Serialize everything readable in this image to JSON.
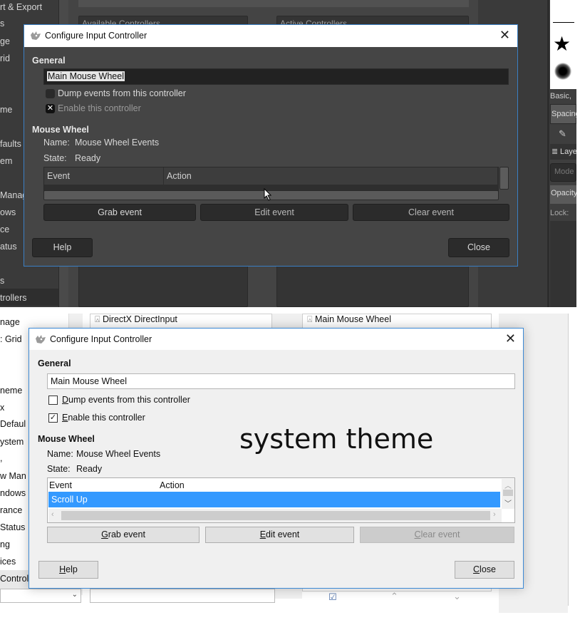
{
  "dark_theme": {
    "sidebar_items": [
      "rt & Export",
      "s",
      "ge",
      "rid",
      "me",
      "faults",
      "em",
      "Manag",
      "ows",
      "ce",
      "atus",
      "s",
      "trollers"
    ],
    "available_controllers_label": "Available Controllers",
    "active_controllers_label": "Active Controllers",
    "right_dock": {
      "brush_preset_label": "Basic,",
      "spacing_label": "Spacing",
      "layers_label": "Laye",
      "mode_label": "Mode",
      "opacity_label": "Opacity",
      "lock_label": "Lock:"
    },
    "dialog": {
      "title": "Configure Input Controller",
      "general_header": "General",
      "name_value": "Main Mouse Wheel",
      "dump_events_label": "Dump events from this controller",
      "dump_events_checked": false,
      "enable_label": "Enable this controller",
      "enable_checked": true,
      "section_header": "Mouse Wheel",
      "name_label": "Name:",
      "name_info": "Mouse Wheel Events",
      "state_label": "State:",
      "state_info": "Ready",
      "table_headers": [
        "Event",
        "Action"
      ],
      "buttons": {
        "grab": "Grab event",
        "edit": "Edit event",
        "clear": "Clear event",
        "help": "Help",
        "close": "Close"
      }
    }
  },
  "system_theme": {
    "watermark": "system theme",
    "sidebar_items": [
      "nage",
      ": Grid",
      "neme",
      "x",
      "Defaul",
      "ystem",
      ",",
      "w Man",
      "ndows",
      "rance",
      "Status",
      "ng",
      "ices",
      "Control"
    ],
    "available_controller_item": "DirectX DirectInput",
    "active_controller_item": "Main Mouse Wheel",
    "dialog": {
      "title": "Configure Input Controller",
      "general_header": "General",
      "name_value": "Main Mouse Wheel",
      "dump_events_label": "Dump events from this controller",
      "dump_events_checked": false,
      "enable_label": "Enable this controller",
      "enable_checked": true,
      "section_header": "Mouse Wheel",
      "name_label": "Name:",
      "name_info": "Mouse Wheel Events",
      "state_label": "State:",
      "state_info": "Ready",
      "table_headers": [
        "Event",
        "Action"
      ],
      "rows": [
        {
          "event": "Scroll Up",
          "action": ""
        }
      ],
      "buttons": {
        "grab": "Grab event",
        "edit": "Edit event",
        "clear": "Clear event",
        "help": "Help",
        "close": "Close"
      }
    }
  },
  "colors": {
    "selection_blue": "#3399ff",
    "window_border": "#3c8ad6",
    "dark_bg": "#454545"
  }
}
